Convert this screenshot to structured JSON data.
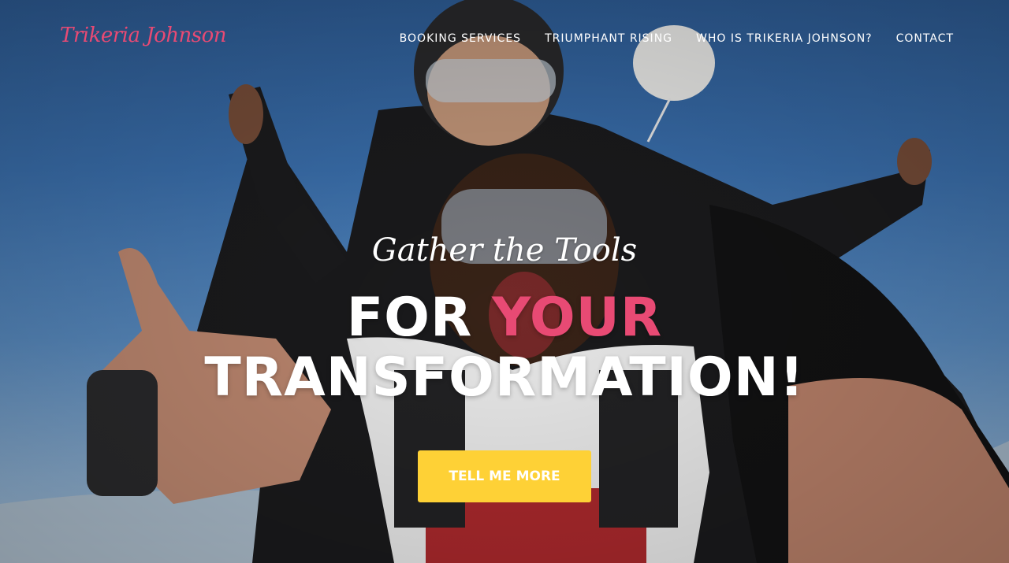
{
  "brand": {
    "logo_text": "Trikeria Johnson"
  },
  "nav": {
    "items": [
      {
        "label": "BOOKING SERVICES"
      },
      {
        "label": "TRIUMPHANT RISING"
      },
      {
        "label": "WHO IS TRIKERIA JOHNSON?"
      },
      {
        "label": "CONTACT"
      }
    ]
  },
  "hero": {
    "subheading": "Gather the Tools",
    "heading_part1": "FOR",
    "heading_accent": "YOUR",
    "heading_part2": "TRANSFORMATION!",
    "cta_label": "TELL ME MORE",
    "background": "skydiving tandem selfie photo"
  },
  "colors": {
    "accent_pink": "#e84a74",
    "cta_yellow": "#fed136",
    "text_white": "#ffffff"
  }
}
